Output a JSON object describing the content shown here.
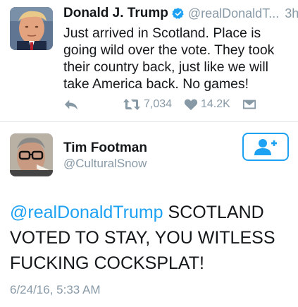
{
  "colors": {
    "accent": "#1da1f2",
    "muted": "#8899a6",
    "text": "#14171a"
  },
  "tweet": {
    "author": {
      "display_name": "Donald J. Trump",
      "handle": "@realDonaldT...",
      "verified": true
    },
    "time": "3h",
    "text": "Just arrived in Scotland. Place is going wild over the vote. They took their country back, just like we will take America back. No games!",
    "actions": {
      "reply_icon": "reply-icon",
      "retweet_icon": "retweet-icon",
      "retweets": "7,034",
      "like_icon": "heart-icon",
      "likes": "14.2K",
      "dm_icon": "direct-message-icon"
    }
  },
  "reply": {
    "author": {
      "display_name": "Tim Footman",
      "handle": "@CulturalSnow"
    },
    "follow_icon": "add-user-icon",
    "mention": "@realDonaldTrump",
    "text": " SCOTLAND VOTED TO STAY, YOU WITLESS FUCKING COCKSPLAT!",
    "timestamp": "6/24/16, 5:33 AM"
  }
}
